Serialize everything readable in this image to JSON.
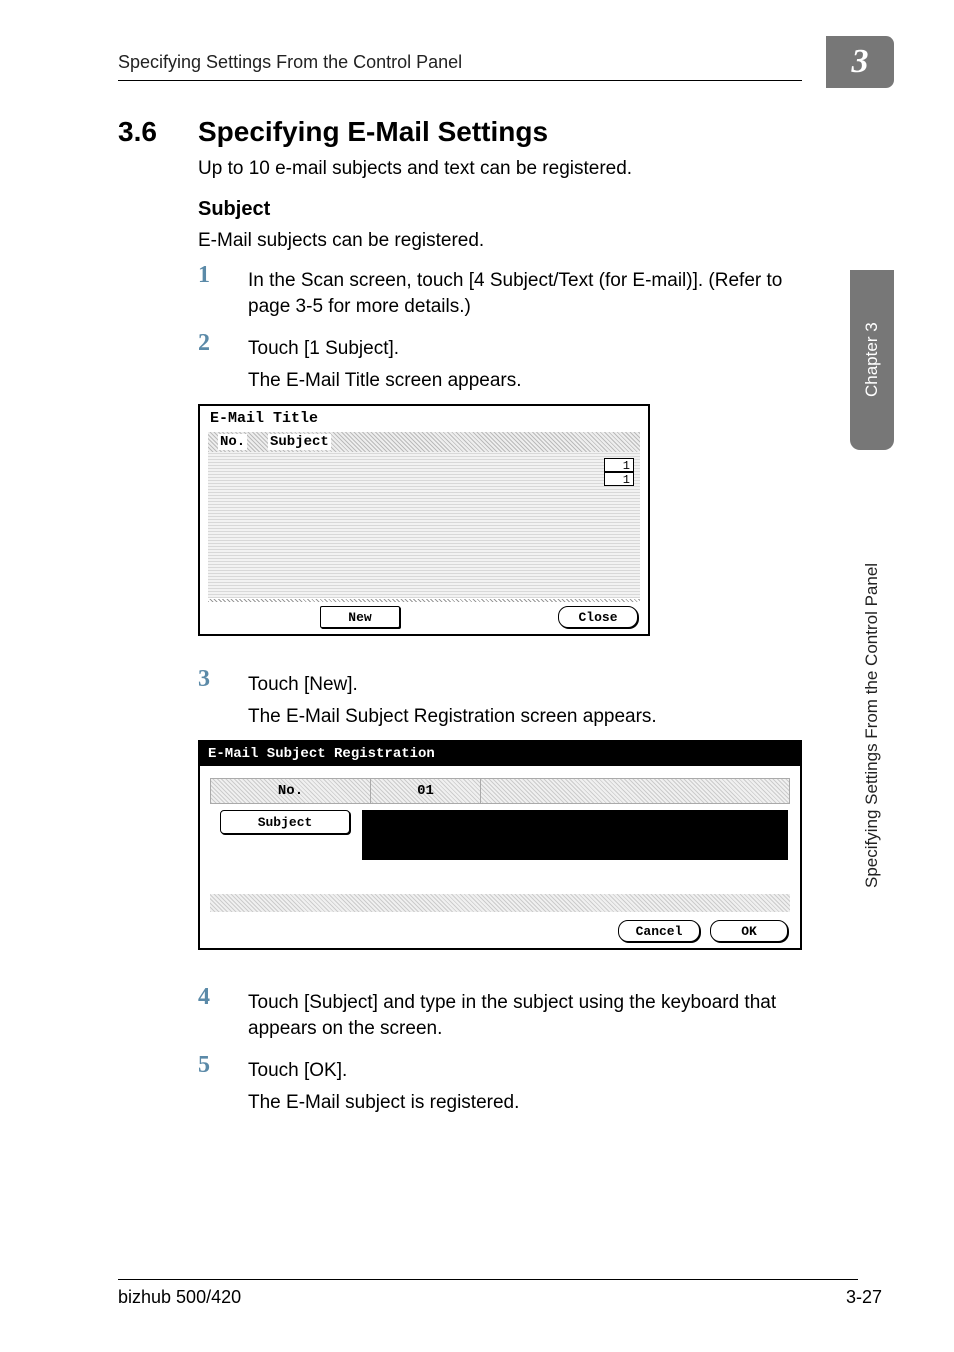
{
  "header": {
    "running_head": "Specifying Settings From the Control Panel",
    "corner_number": "3"
  },
  "side": {
    "chapter": "Chapter 3",
    "label": "Specifying Settings From the Control Panel"
  },
  "section": {
    "num": "3.6",
    "title": "Specifying E-Mail Settings",
    "intro": "Up to 10 e-mail subjects and text can be registered."
  },
  "subject": {
    "heading": "Subject",
    "intro": "E-Mail subjects can be registered."
  },
  "steps": {
    "s1": {
      "num": "1",
      "text": "In the Scan screen, touch [4 Subject/Text (for E-mail)]. (Refer to page 3-5 for more details.)"
    },
    "s2": {
      "num": "2",
      "text": "Touch [1 Subject].",
      "sub": "The E-Mail Title screen appears."
    },
    "s3": {
      "num": "3",
      "text": "Touch [New].",
      "sub": "The E-Mail Subject Registration screen appears."
    },
    "s4": {
      "num": "4",
      "text": "Touch [Subject] and type in the subject using the keyboard that appears on the screen."
    },
    "s5": {
      "num": "5",
      "text": "Touch [OK].",
      "sub": "The E-Mail subject is registered."
    }
  },
  "shot1": {
    "title": "E-Mail Title",
    "col_no": "No.",
    "col_subject": "Subject",
    "page_cur": "1",
    "page_tot": "1",
    "btn_new": "New",
    "btn_close": "Close"
  },
  "shot2": {
    "title": "E-Mail Subject Registration",
    "no_label": "No.",
    "no_value": "01",
    "subject_btn": "Subject",
    "btn_cancel": "Cancel",
    "btn_ok": "OK"
  },
  "footer": {
    "left": "bizhub 500/420",
    "right": "3-27"
  }
}
